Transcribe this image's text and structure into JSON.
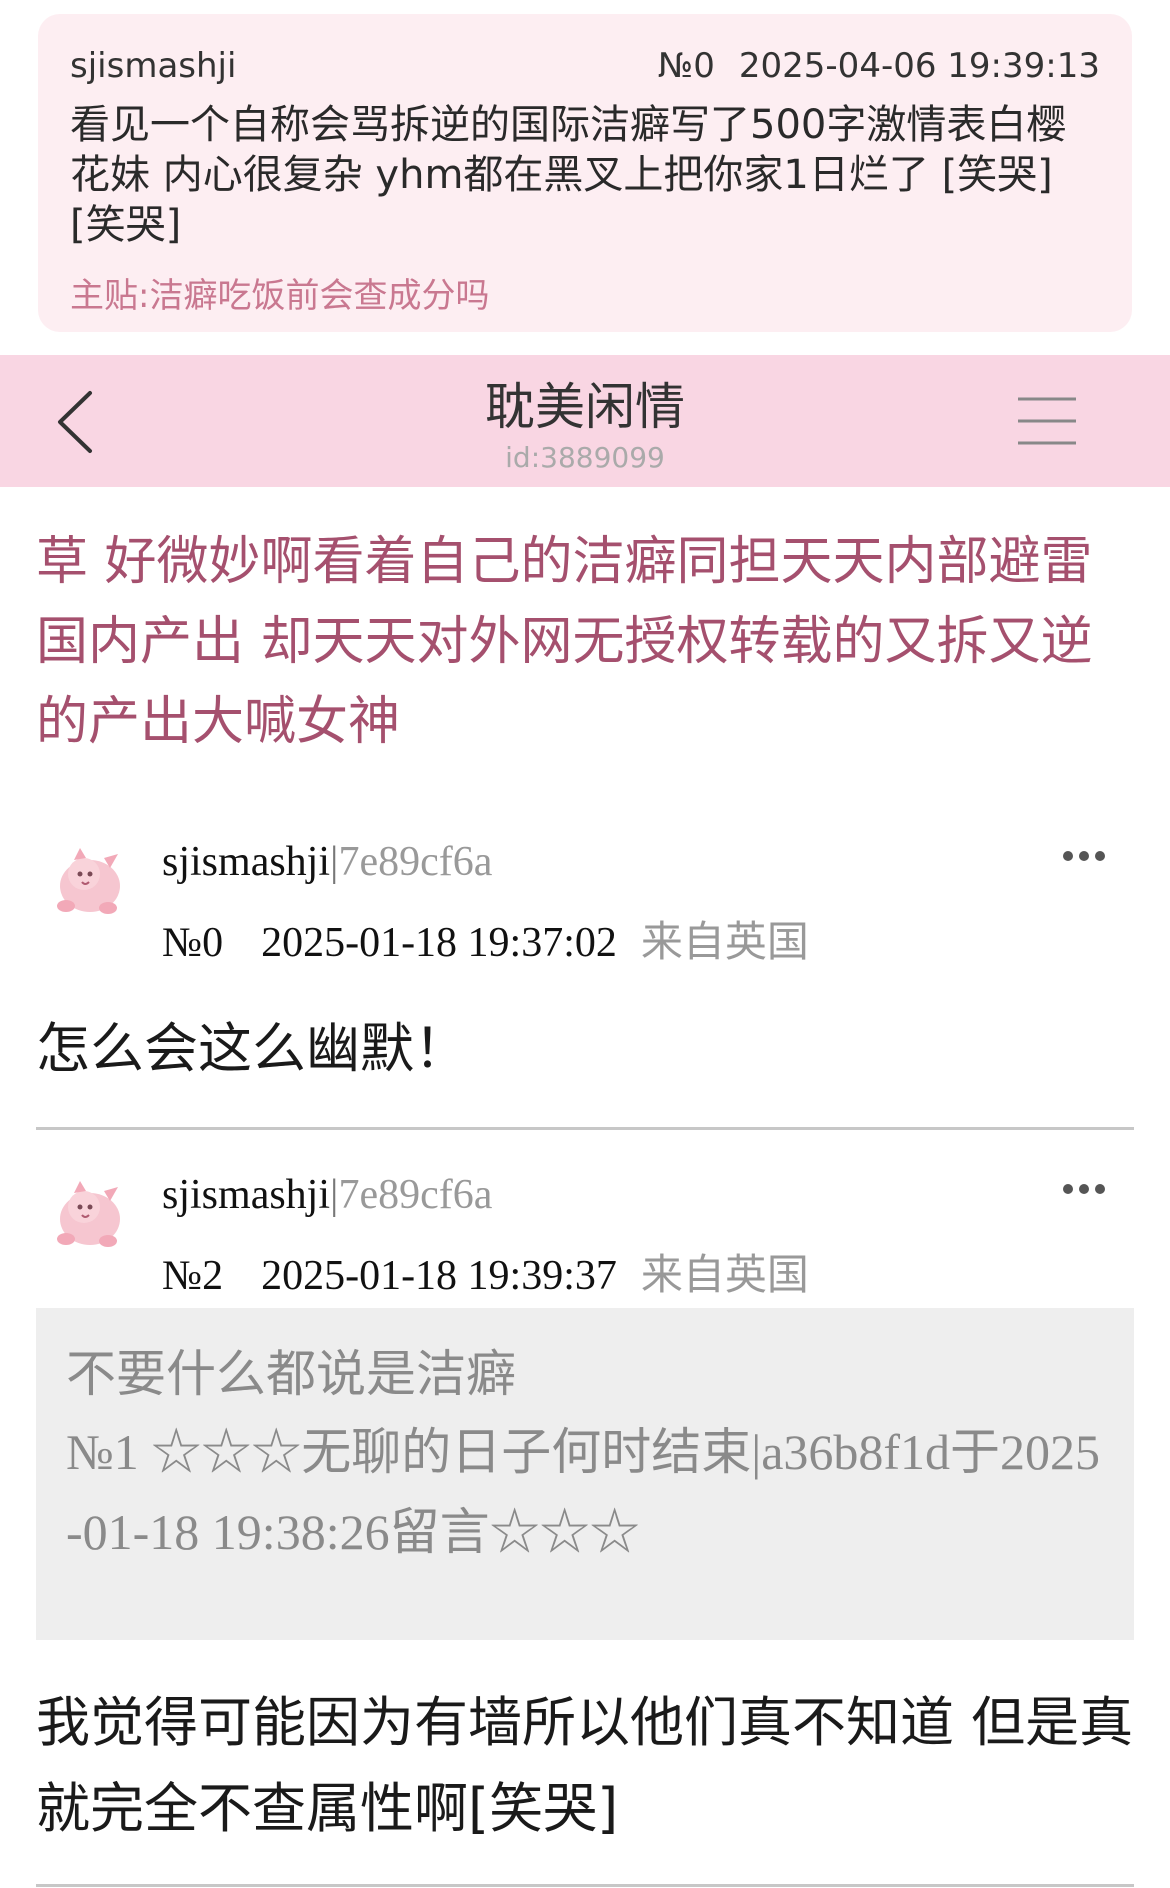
{
  "quote": {
    "user": "sjismashji",
    "floor": "№0",
    "time": "2025-04-06 19:39:13",
    "text": "看见一个自称会骂拆逆的国际洁癖写了500字激情表白樱花妹 内心很复杂 yhm都在黑叉上把你家1日烂了 [笑哭][笑哭]",
    "source": "主贴:洁癖吃饭前会查成分吗"
  },
  "header": {
    "title": "耽美闲情",
    "id": "id:3889099"
  },
  "thread": {
    "title": "草 好微妙啊看着自己的洁癖同担天天内部避雷国内产出 却天天对外网无授权转载的又拆又逆的产出大喊女神"
  },
  "posts": [
    {
      "user": "sjismashji",
      "sep": "|",
      "hash": "7e89cf6a",
      "floor": "№0",
      "time": "2025-01-18 19:37:02",
      "location": "来自英国",
      "text": "怎么会这么幽默！"
    },
    {
      "user": "sjismashji",
      "sep": "|",
      "hash": "7e89cf6a",
      "floor": "№2",
      "time": "2025-01-18 19:39:37",
      "location": "来自英国",
      "reply": {
        "text": "不要什么都说是洁癖",
        "meta": "№1 ☆☆☆无聊的日子何时结束|a36b8f1d于2025-01-18 19:38:26留言☆☆☆"
      },
      "text": "我觉得可能因为有墙所以他们真不知道 但是真就完全不查属性啊[笑哭]"
    }
  ],
  "colors": {
    "header_bg": "#f9d6e3",
    "quote_bg": "#fdeef2",
    "thread_title": "#a5506e",
    "source_link": "#c97890",
    "reply_bg": "#eeeeee"
  },
  "icons": [
    "back-arrow-icon",
    "menu-icon",
    "more-dots-icon",
    "avatar-pink-creature"
  ]
}
